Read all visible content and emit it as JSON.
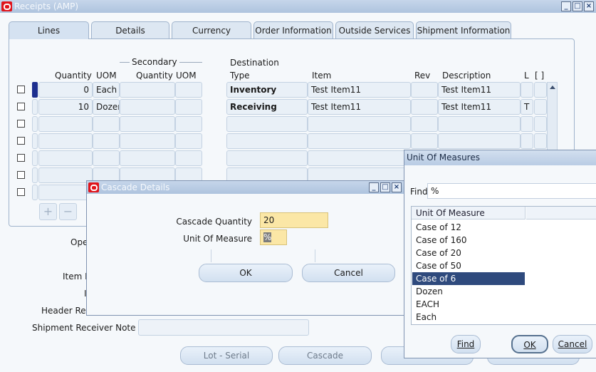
{
  "window": {
    "title": "Receipts (AMP)"
  },
  "tabs": [
    "Lines",
    "Details",
    "Currency",
    "Order Information",
    "Outside Services",
    "Shipment Information"
  ],
  "lines_table": {
    "secondary_group": "Secondary",
    "destination_group": "Destination",
    "headers": {
      "quantity": "Quantity",
      "uom": "UOM",
      "secondary_quantity": "Quantity",
      "secondary_uom": "UOM",
      "destination_type": "Type",
      "item": "Item",
      "rev": "Rev",
      "description": "Description",
      "l": "L",
      "flex": "[ ]"
    },
    "rows": [
      {
        "quantity": "0",
        "uom": "Each",
        "destination_type": "Inventory",
        "item": "Test Item11",
        "description": "Test Item11",
        "l": ""
      },
      {
        "quantity": "10",
        "uom": "Dozer",
        "destination_type": "Receiving",
        "item": "Test Item11",
        "description": "Test Item11",
        "l": "T"
      }
    ]
  },
  "header_area": {
    "ope_label": "Ope",
    "item_label": "Item I",
    "i_label": "I",
    "header_receiver_label": "Header Re",
    "shipment_receiver_note_label": "Shipment Receiver Note"
  },
  "bottom_buttons": {
    "lot_serial": "Lot - Serial",
    "cascade": "Cascade"
  },
  "cascade_dialog": {
    "title": "Cascade Details",
    "quantity_label": "Cascade Quantity",
    "quantity_value": "20",
    "uom_label": "Unit Of Measure",
    "uom_value": "%",
    "ok": "OK",
    "cancel": "Cancel"
  },
  "uom_dialog": {
    "title": "Unit Of Measures",
    "find_label": "Find",
    "find_value": "%",
    "column_header": "Unit Of Measure",
    "items": [
      "Case of 12",
      "Case of 160",
      "Case of 20",
      "Case of 50",
      "Case of 6",
      "Dozen",
      "EACH",
      "Each"
    ],
    "selected_index": 4,
    "find_button": "Find",
    "ok_button": "OK",
    "cancel_button": "Cancel"
  },
  "colors": {
    "titlebar": "#aec3de",
    "selection": "#2f4a7d",
    "required_field": "#fbe7a6",
    "oracle_red": "#e0141b"
  }
}
